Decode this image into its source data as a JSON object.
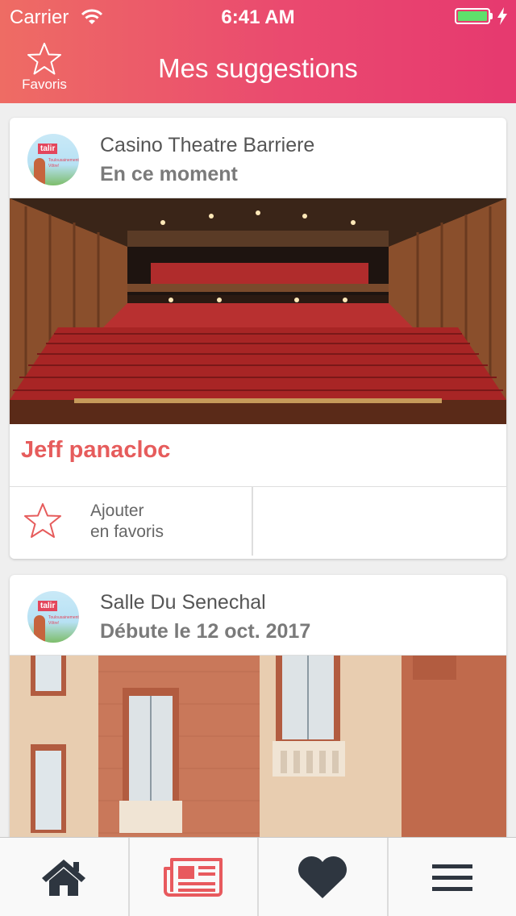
{
  "status_bar": {
    "carrier": "Carrier",
    "time": "6:41 AM",
    "battery_level": 1.0
  },
  "header": {
    "favorites_label": "Favoris",
    "title": "Mes suggestions"
  },
  "cards": [
    {
      "venue": "Casino Theatre Barriere",
      "when": "En ce moment",
      "title": "Jeff panacloc",
      "add_fav_line1": "Ajouter",
      "add_fav_line2": "en favoris",
      "avatar_tag": "talir",
      "avatar_sub": "Toulousainement Vôtre!"
    },
    {
      "venue": "Salle Du Senechal",
      "when": "Débute le 12 oct. 2017",
      "avatar_tag": "talir",
      "avatar_sub": "Toulousainement Vôtre!"
    }
  ],
  "tabbar": {
    "items": [
      {
        "icon": "home-icon",
        "active": false
      },
      {
        "icon": "news-icon",
        "active": true
      },
      {
        "icon": "heart-icon",
        "active": false
      },
      {
        "icon": "menu-icon",
        "active": false
      }
    ]
  },
  "colors": {
    "accent": "#e65c5c",
    "header_start": "#ee6c64",
    "header_end": "#e6396f",
    "tab_active": "#e85a5e",
    "tab_inactive": "#2e3640"
  }
}
